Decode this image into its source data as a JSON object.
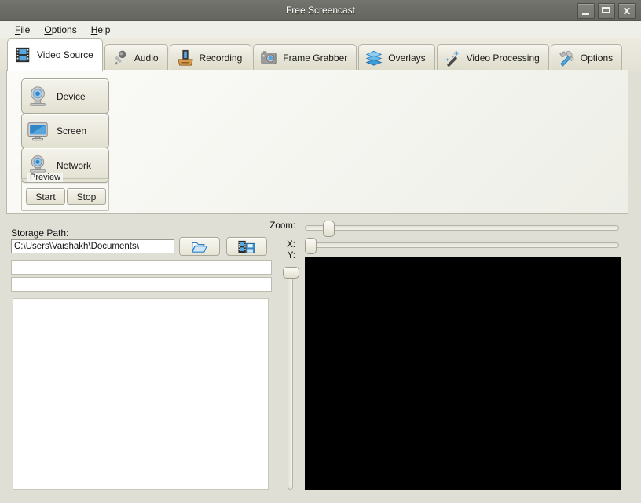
{
  "window": {
    "title": "Free Screencast",
    "controls": [
      {
        "name": "minimize",
        "glyph": "–"
      },
      {
        "name": "maximize",
        "glyph": "▭"
      },
      {
        "name": "close",
        "glyph": "X"
      }
    ]
  },
  "menubar": {
    "items": [
      {
        "mnemonic": "F",
        "rest": "ile"
      },
      {
        "mnemonic": "O",
        "rest": "ptions"
      },
      {
        "mnemonic": "H",
        "rest": "elp"
      }
    ]
  },
  "tabs": [
    {
      "label": "Video Source",
      "icon": "filmstrip-icon",
      "active": true
    },
    {
      "label": "Audio",
      "icon": "microphone-icon",
      "active": false
    },
    {
      "label": "Recording",
      "icon": "film-in-tray-icon",
      "active": false
    },
    {
      "label": "Frame Grabber",
      "icon": "camera-icon",
      "active": false
    },
    {
      "label": "Overlays",
      "icon": "layers-icon",
      "active": false
    },
    {
      "label": "Video Processing",
      "icon": "magic-wand-icon",
      "active": false
    },
    {
      "label": "Options",
      "icon": "hammer-wrench-icon",
      "active": false
    }
  ],
  "video_source": {
    "buttons": [
      {
        "label": "Device",
        "icon": "webcam-icon"
      },
      {
        "label": "Screen",
        "icon": "monitor-icon"
      },
      {
        "label": "Network",
        "icon": "network-camera-icon"
      }
    ],
    "preview_group": {
      "legend": "Preview",
      "start_label": "Start",
      "stop_label": "Stop"
    }
  },
  "storage": {
    "label": "Storage Path:",
    "path_value": "C:\\Users\\Vaishakh\\Documents\\",
    "path_placeholder": "",
    "browse_icon": "folder-open-icon",
    "save_icon": "save-video-icon",
    "field1_value": "",
    "field1_placeholder": "",
    "field2_value": "",
    "field2_placeholder": "",
    "list_items": []
  },
  "preview_controls": {
    "zoom_label": "Zoom:",
    "x_label": "X:",
    "y_label": "Y:",
    "zoom_value_pct": 6,
    "x_value_pct": 0,
    "y_value_pct": 0
  },
  "colors": {
    "titlebar": "#6d6d67",
    "window_bg": "#dfdfd6",
    "panel_bg": "#f4f4ef",
    "tab_active_bg": "#ffffff",
    "preview_bg": "#000000",
    "accent_blue": "#2f7fc6"
  }
}
